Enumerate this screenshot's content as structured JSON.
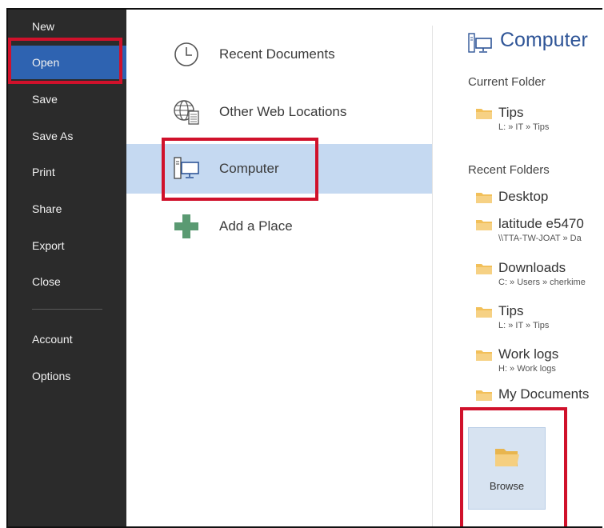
{
  "nav": {
    "items": [
      {
        "label": "New"
      },
      {
        "label": "Open",
        "selected": true
      },
      {
        "label": "Save"
      },
      {
        "label": "Save As"
      },
      {
        "label": "Print"
      },
      {
        "label": "Share"
      },
      {
        "label": "Export"
      },
      {
        "label": "Close"
      },
      {
        "label": "Account"
      },
      {
        "label": "Options"
      }
    ]
  },
  "places": {
    "items": [
      {
        "label": "Recent Documents",
        "icon": "clock-icon"
      },
      {
        "label": "Other Web Locations",
        "icon": "globe-icon"
      },
      {
        "label": "Computer",
        "icon": "computer-icon",
        "selected": true
      },
      {
        "label": "Add a Place",
        "icon": "plus-icon"
      }
    ]
  },
  "right": {
    "title": "Computer",
    "current_folder_heading": "Current Folder",
    "current_folder": {
      "name": "Tips",
      "path": "L: » IT » Tips"
    },
    "recent_folders_heading": "Recent Folders",
    "recent_folders": [
      {
        "name": "Desktop",
        "path": ""
      },
      {
        "name": "latitude e5470",
        "path": "\\\\TTA-TW-JOAT » Da"
      },
      {
        "name": "Downloads",
        "path": "C: » Users » cherkime"
      },
      {
        "name": "Tips",
        "path": "L: » IT » Tips"
      },
      {
        "name": "Work logs",
        "path": "H: » Work logs"
      },
      {
        "name": "My Documents",
        "path": ""
      }
    ],
    "browse_label": "Browse"
  },
  "colors": {
    "nav_bg": "#2b2b2b",
    "nav_selected": "#2e63b1",
    "place_selected": "#c5d9f1",
    "highlight_box": "#d0112b",
    "title_blue": "#2f5597",
    "folder_yellow": "#f2c05a"
  }
}
